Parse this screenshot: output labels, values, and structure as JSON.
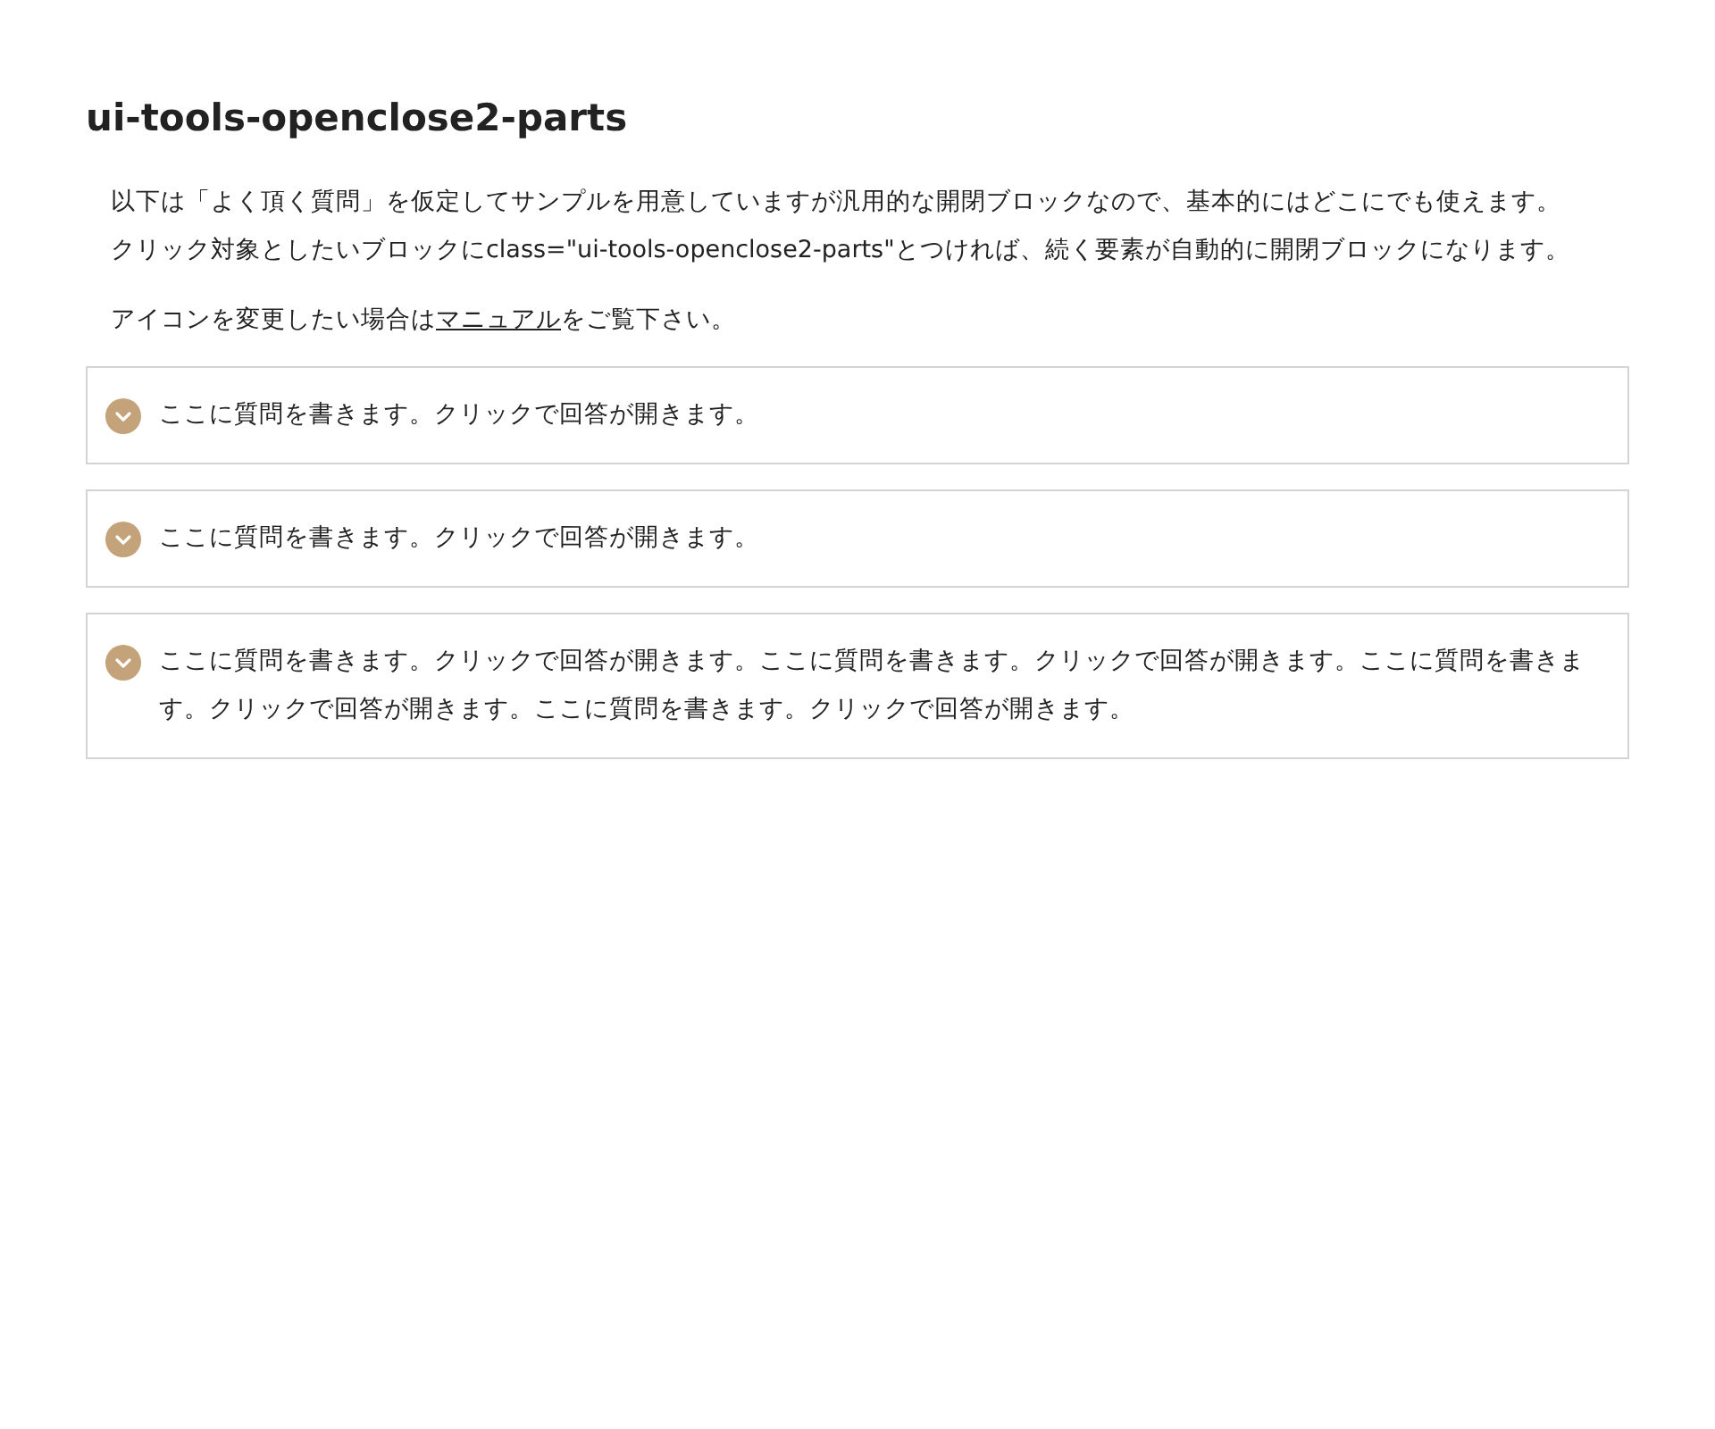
{
  "title": "ui-tools-openclose2-parts",
  "intro": [
    "以下は「よく頂く質問」を仮定してサンプルを用意していますが汎用的な開閉ブロックなので、基本的にはどこにでも使えます。",
    "クリック対象としたいブロックにclass=\"ui-tools-openclose2-parts\"とつければ、続く要素が自動的に開閉ブロックになります。"
  ],
  "note": {
    "before": "アイコンを変更したい場合は",
    "link": "マニュアル",
    "after": "をご覧下さい。"
  },
  "questions": [
    {
      "text": "ここに質問を書きます。クリックで回答が開きます。",
      "expanded": false
    },
    {
      "text": "ここに質問を書きます。クリックで回答が開きます。",
      "expanded": false
    },
    {
      "text": "ここに質問を書きます。クリックで回答が開きます。ここに質問を書きます。クリックで回答が開きます。ここに質問を書きます。クリックで回答が開きます。ここに質問を書きます。クリックで回答が開きます。",
      "expanded": false
    }
  ]
}
